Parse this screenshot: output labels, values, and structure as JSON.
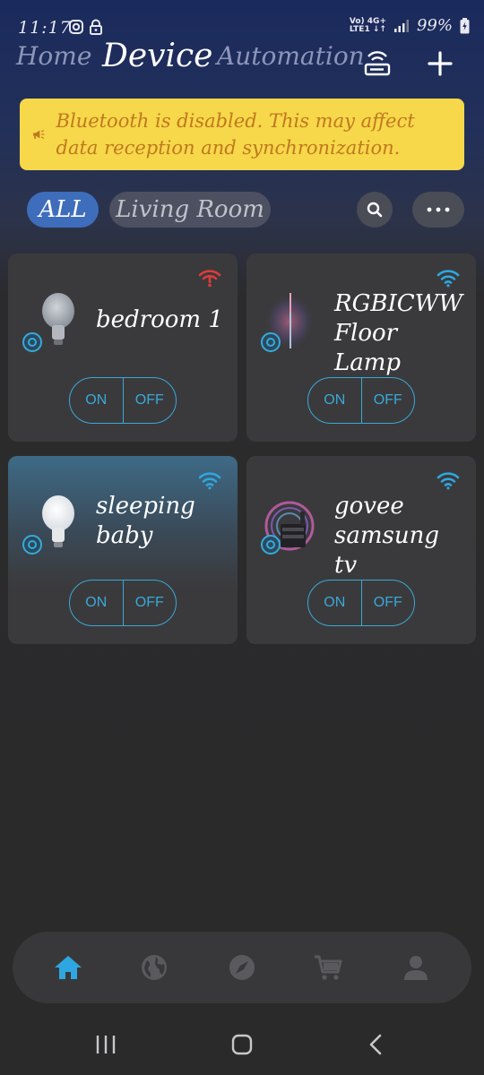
{
  "status": {
    "time": "11:17",
    "net_top": "Vo) 4G+",
    "net_bottom": "LTE1 ↓↑",
    "battery": "99%"
  },
  "tabs": [
    {
      "label": "Home"
    },
    {
      "label": "Device"
    },
    {
      "label": "Automation"
    }
  ],
  "banner": {
    "text": "Bluetooth is disabled. This may affect data reception and synchronization."
  },
  "filters": [
    {
      "label": "ALL"
    },
    {
      "label": "Living Room"
    }
  ],
  "devices": [
    {
      "name": "bedroom 1",
      "on": "ON",
      "off": "OFF",
      "wifi": "offline-wifi-icon"
    },
    {
      "name": "RGBICWW Floor Lamp",
      "on": "ON",
      "off": "OFF",
      "wifi": "wifi-icon"
    },
    {
      "name": "sleeping baby",
      "on": "ON",
      "off": "OFF",
      "wifi": "wifi-icon"
    },
    {
      "name": "govee samsung tv",
      "on": "ON",
      "off": "OFF",
      "wifi": "wifi-icon"
    }
  ],
  "colors": {
    "accent": "#3aa8d8",
    "banner_bg": "#f6d84a",
    "banner_text": "#c0781e",
    "chip_active": "#3e6dbc",
    "offline": "#e03a3a"
  }
}
